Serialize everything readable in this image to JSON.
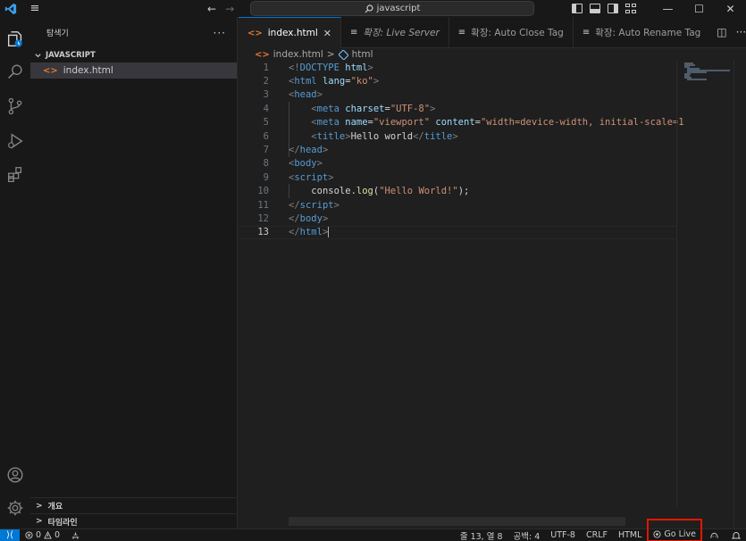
{
  "titlebar": {
    "search_text": "javascript",
    "back_arrow": "←",
    "forward_arrow": "→",
    "minimize": "—",
    "maximize": "☐",
    "close": "✕"
  },
  "sidebar": {
    "title": "탐색기",
    "more": "···",
    "section": "JAVASCRIPT",
    "files": [
      {
        "name": "index.html",
        "icon": "<>"
      }
    ],
    "bottom_sections": [
      {
        "label": "개요",
        "chevron": ">"
      },
      {
        "label": "타임라인",
        "chevron": ">"
      }
    ]
  },
  "tabs": [
    {
      "icon": "<>",
      "label": "index.html",
      "active": true,
      "close": "✕"
    },
    {
      "icon": "≡",
      "label": "확장: Live Server",
      "italic": true
    },
    {
      "icon": "≡",
      "label": "확장: Auto Close Tag"
    },
    {
      "icon": "≡",
      "label": "확장: Auto Rename Tag"
    }
  ],
  "tab_actions": {
    "split": "◫",
    "more": "···"
  },
  "breadcrumb": {
    "file": "index.html",
    "sep": ">",
    "symbol": "html"
  },
  "editor": {
    "lines": [
      {
        "n": "1"
      },
      {
        "n": "2"
      },
      {
        "n": "3"
      },
      {
        "n": "4"
      },
      {
        "n": "5"
      },
      {
        "n": "6"
      },
      {
        "n": "7"
      },
      {
        "n": "8"
      },
      {
        "n": "9"
      },
      {
        "n": "10"
      },
      {
        "n": "11"
      },
      {
        "n": "12"
      },
      {
        "n": "13"
      }
    ],
    "code": {
      "l1_a": "<!",
      "l1_b": "DOCTYPE",
      "l1_c": " html",
      "l1_d": ">",
      "l2_tag": "html",
      "l2_attr": " lang",
      "l2_eq": "=",
      "l2_val": "\"ko\"",
      "l3_tag": "head",
      "l4_tag": "meta",
      "l4_attr": " charset",
      "l4_val": "\"UTF-8\"",
      "l5_tag": "meta",
      "l5_attr1": " name",
      "l5_val1": "\"viewport\"",
      "l5_attr2": " content",
      "l5_val2": "\"width=device-width, initial-scale=1",
      "l6_tag": "title",
      "l6_text": "Hello world",
      "l7_tag": "head",
      "l8_tag": "body",
      "l9_tag": "script",
      "l10_obj": "console",
      "l10_dot": ".",
      "l10_fn": "log",
      "l10_open": "(",
      "l10_str": "\"Hello World!\"",
      "l10_close": ");",
      "l11_tag": "script",
      "l12_tag": "body",
      "l13_tag": "html"
    }
  },
  "statusbar": {
    "remote": "⟩⟨",
    "errors": "0",
    "warnings": "0",
    "position": "줄 13, 열 8",
    "spaces": "공백: 4",
    "encoding": "UTF-8",
    "eol": "CRLF",
    "language": "HTML",
    "golive": "Go Live"
  },
  "colors": {
    "accent": "#0078d4",
    "highlight_box": "#e51400",
    "tag": "#569cd6",
    "attribute": "#9cdcfe",
    "string": "#ce9178"
  }
}
